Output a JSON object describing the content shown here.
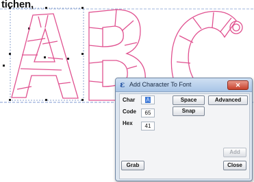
{
  "top_text": "tichen,",
  "dialog": {
    "title": "Add Character To Font",
    "app_icon": "ε",
    "close_glyph": "✕",
    "char_label": "Char",
    "char_value": "A",
    "code_label": "Code",
    "code_value": "65",
    "hex_label": "Hex",
    "hex_value": "41",
    "space_button": "Space",
    "advanced_button": "Advanced",
    "snap_button": "Snap",
    "add_button": "Add",
    "grab_button": "Grab",
    "close_button": "Close"
  },
  "colors": {
    "letter_outline": "#e0508f",
    "guide_line": "#7f9ad0",
    "dialog_bg": "#dde6f0"
  },
  "icons": {
    "app_icon": "app-logo-icon",
    "close_icon": "close-icon"
  }
}
